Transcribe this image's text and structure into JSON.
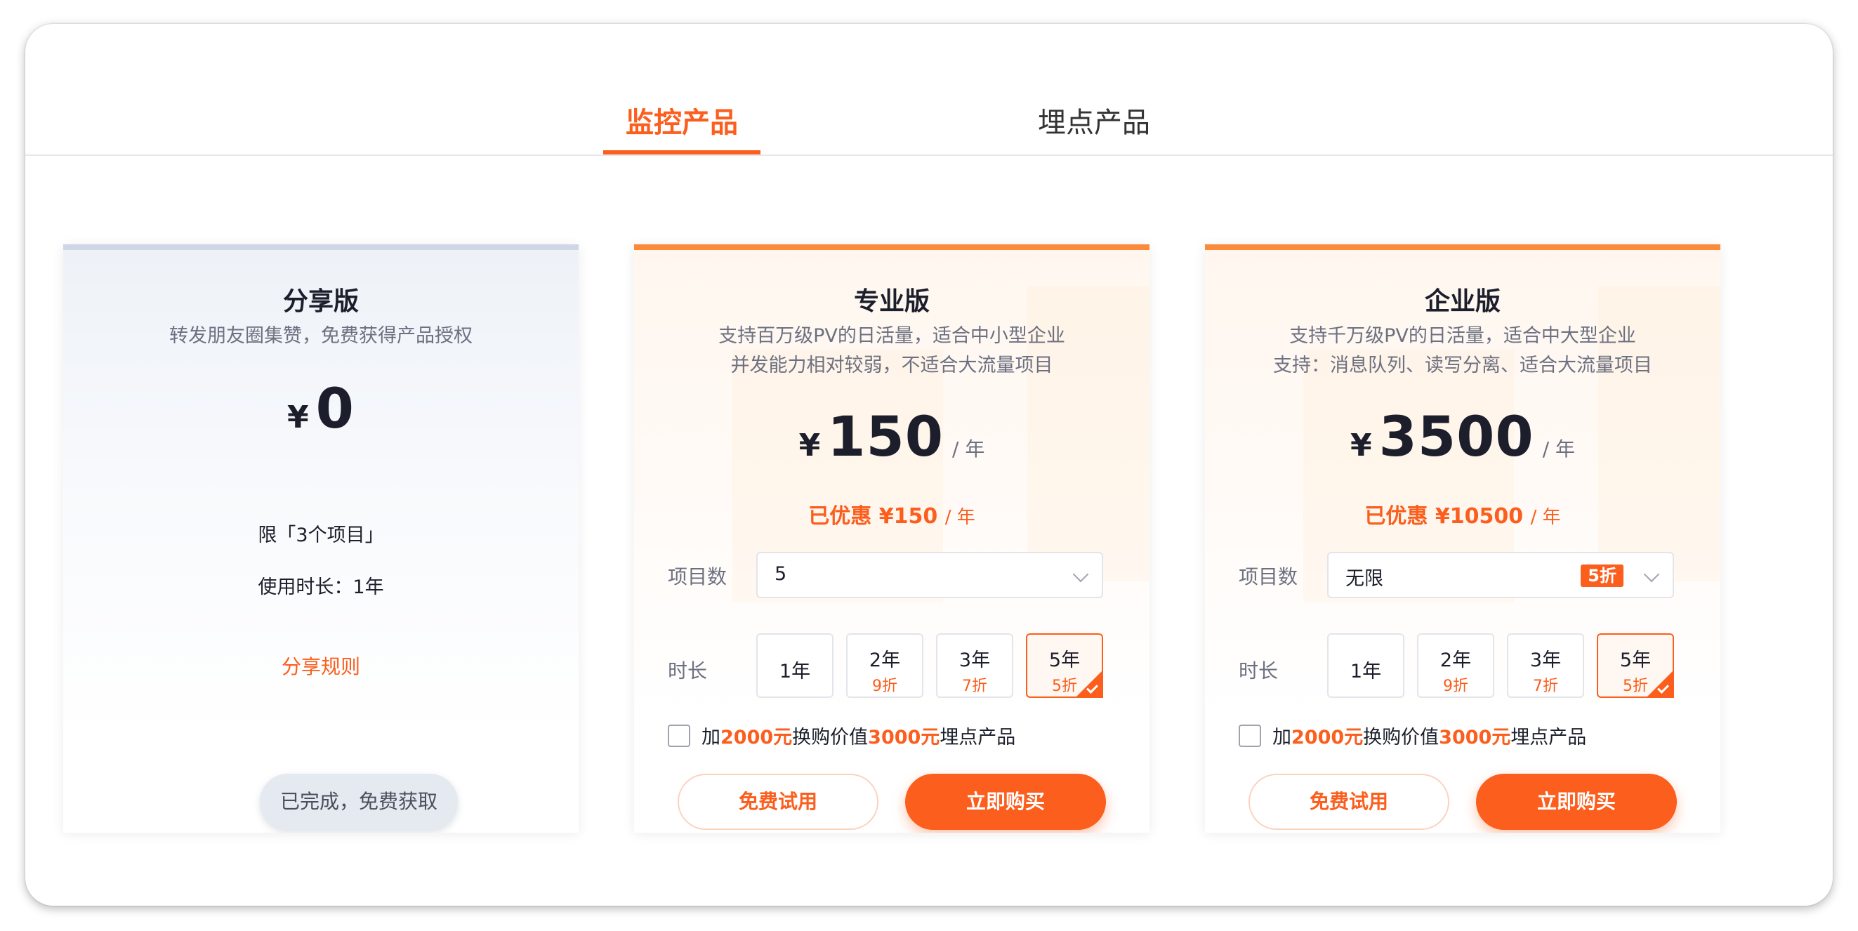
{
  "tabs": [
    {
      "label": "监控产品",
      "active": true
    },
    {
      "label": "埋点产品",
      "active": false
    }
  ],
  "colors": {
    "accent": "#fb5e1d",
    "text": "#1c1f2b",
    "muted": "#6c7080"
  },
  "plans": [
    {
      "title": "分享版",
      "desc1": "转发朋友圈集赞，免费获得产品授权",
      "currency": "¥",
      "price": "0",
      "limit": "限「3个项目」",
      "duration": "使用时长：1年",
      "rule_link": "分享规则",
      "button": "已完成，免费获取"
    },
    {
      "title": "专业版",
      "desc1": "支持百万级PV的日活量，适合中小型企业",
      "desc2": "并发能力相对较弱，不适合大流量项目",
      "currency": "¥",
      "price": "150",
      "unit": "/ 年",
      "saving_label": "已优惠",
      "saving_amount": "¥150",
      "saving_unit": "/ 年",
      "projects_label": "项目数",
      "projects_value": "5",
      "projects_badge": "",
      "duration_label": "时长",
      "durations": [
        {
          "year": "1年",
          "discount": ""
        },
        {
          "year": "2年",
          "discount": "9折"
        },
        {
          "year": "3年",
          "discount": "7折"
        },
        {
          "year": "5年",
          "discount": "5折",
          "selected": true
        }
      ],
      "addon_prefix": "加",
      "addon_price": "2000元",
      "addon_mid": "换购价值",
      "addon_value": "3000元",
      "addon_suffix": "埋点产品",
      "trial_button": "免费试用",
      "buy_button": "立即购买"
    },
    {
      "title": "企业版",
      "desc1": "支持千万级PV的日活量，适合中大型企业",
      "desc2": "支持：消息队列、读写分离、适合大流量项目",
      "currency": "¥",
      "price": "3500",
      "unit": "/ 年",
      "saving_label": "已优惠",
      "saving_amount": "¥10500",
      "saving_unit": "/ 年",
      "projects_label": "项目数",
      "projects_value": "无限",
      "projects_badge": "5折",
      "duration_label": "时长",
      "durations": [
        {
          "year": "1年",
          "discount": ""
        },
        {
          "year": "2年",
          "discount": "9折"
        },
        {
          "year": "3年",
          "discount": "7折"
        },
        {
          "year": "5年",
          "discount": "5折",
          "selected": true
        }
      ],
      "addon_prefix": "加",
      "addon_price": "2000元",
      "addon_mid": "换购价值",
      "addon_value": "3000元",
      "addon_suffix": "埋点产品",
      "trial_button": "免费试用",
      "buy_button": "立即购买"
    }
  ]
}
